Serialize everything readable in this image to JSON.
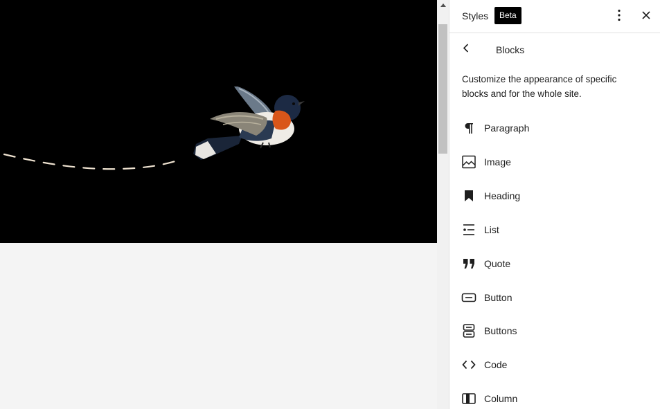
{
  "sidebar": {
    "title": "Styles",
    "badge": "Beta",
    "nav_title": "Blocks",
    "description": "Customize the appearance of specific blocks and for the whole site.",
    "blocks": [
      {
        "label": "Paragraph",
        "icon": "paragraph-icon"
      },
      {
        "label": "Image",
        "icon": "image-icon"
      },
      {
        "label": "Heading",
        "icon": "heading-icon"
      },
      {
        "label": "List",
        "icon": "list-icon"
      },
      {
        "label": "Quote",
        "icon": "quote-icon"
      },
      {
        "label": "Button",
        "icon": "button-icon"
      },
      {
        "label": "Buttons",
        "icon": "buttons-icon"
      },
      {
        "label": "Code",
        "icon": "code-icon"
      },
      {
        "label": "Column",
        "icon": "column-icon"
      }
    ]
  },
  "colors": {
    "hero_background": "#000000",
    "canvas_background": "#f4f4f4",
    "badge_background": "#000000"
  }
}
